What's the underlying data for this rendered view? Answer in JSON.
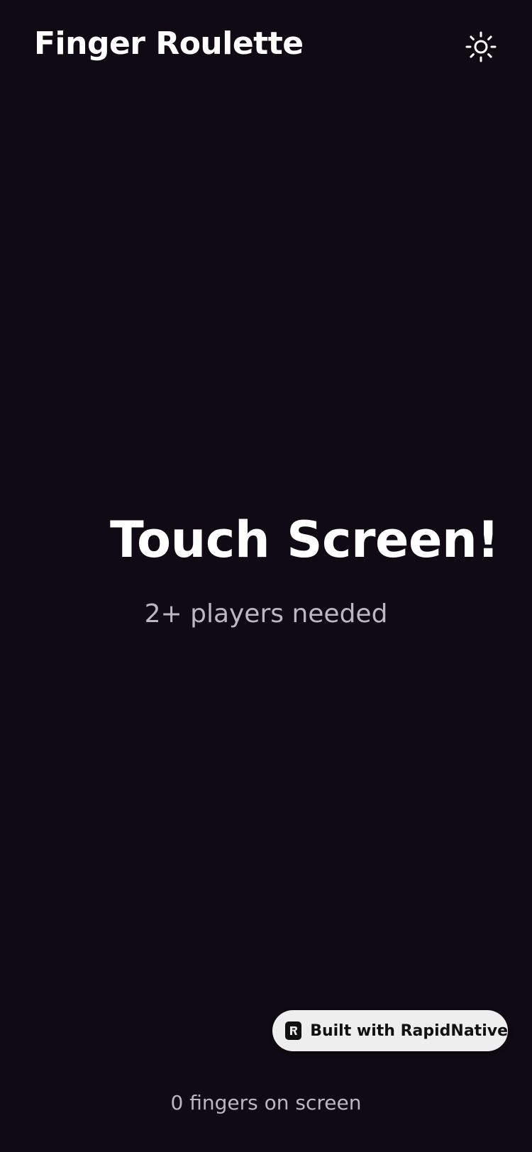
{
  "header": {
    "title": "Finger Roulette",
    "theme_toggle_icon": "sun-icon"
  },
  "main": {
    "title": "Touch Screen!",
    "subtitle": "2+ players needed"
  },
  "badge": {
    "label": "Built with RapidNative",
    "icon": "rapidnative-logo-icon"
  },
  "footer": {
    "status": "0 fingers on screen"
  },
  "colors": {
    "background": "#0f0a14",
    "text_primary": "#ffffff",
    "text_secondary": "#bdb6c4",
    "badge_background": "#eeeeee"
  }
}
